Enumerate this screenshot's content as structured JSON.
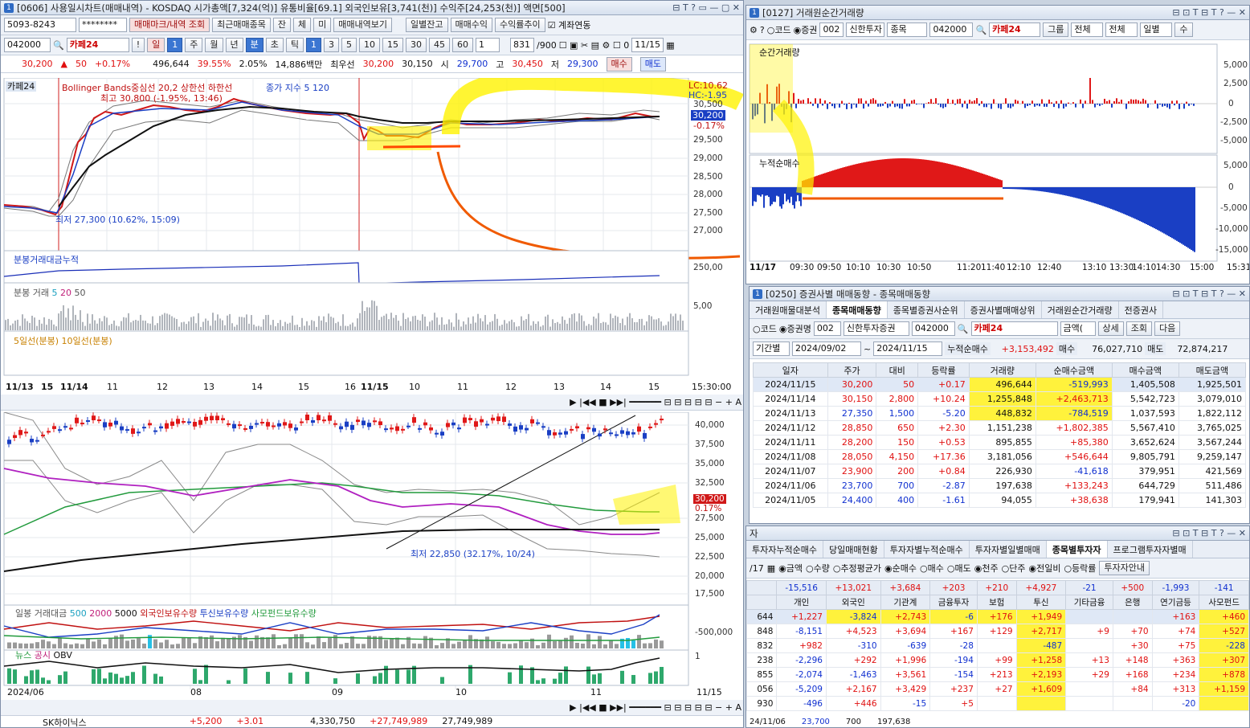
{
  "left_window": {
    "title": "[0606] 사용일시차트(매매내역) - KOSDAQ 시가총액[7,324(억)] 유통비율[69.1] 외국인보유[3,741(천)] 수익주[24,253(천)] 액면[500]",
    "account": "5093-8243",
    "password": "********",
    "buttons": [
      "매매마크/내역 조회",
      "최근매매종목",
      "잔",
      "체",
      "미",
      "매매내역보기",
      "일별잔고",
      "매매수익",
      "수익률추이"
    ],
    "checkbox_label": "계좌연동",
    "code": "042000",
    "stock_name": "카페24",
    "period_buttons": [
      "일",
      "1",
      "주",
      "월",
      "년",
      "분",
      "초",
      "틱",
      "1",
      "3",
      "5",
      "10",
      "15",
      "30",
      "45",
      "60",
      "1"
    ],
    "count": "831",
    "count_total": "/900",
    "date": "11/15",
    "quote": {
      "price": "30,200",
      "change": "50",
      "pct": "+0.17%",
      "volume": "496,644",
      "turnover": "39.55%",
      "ratio": "2.05%",
      "amount": "14,886백만",
      "best_label": "최우선",
      "best_ask": "30,200",
      "best_bid": "30,150",
      "open_label": "시",
      "open": "29,700",
      "high_label": "고",
      "high": "30,450",
      "low_label": "저",
      "low": "29,300",
      "buy": "매수",
      "sell": "매도"
    },
    "chart1": {
      "stock": "카페24",
      "legend": "Bollinger Bands중심선 20,2  상한선 하한선",
      "legend2": "종가 지수 5  120",
      "max_note": "최고 30,800 (-1.95%, 13:46)",
      "min_note": "최저 27,300 (10.62%, 15:09)",
      "lc": "LC:10.62",
      "hc": "HC:-1.95",
      "current": "30,200",
      "current_pct": "-0.17%",
      "yticks": [
        "30,500",
        "29,500",
        "29,000",
        "28,500",
        "28,000",
        "27,500",
        "27,000"
      ],
      "xticks": [
        "11/13",
        "15",
        "11/14",
        "11",
        "12",
        "13",
        "14",
        "15",
        "16",
        "11/15",
        "10",
        "11",
        "12",
        "13",
        "14",
        "15"
      ],
      "end_time": "15:30:00",
      "panel2": "분봉거래대금누적",
      "panel2_val": "250,00",
      "panel3": "분봉 거래",
      "panel3_ma": [
        "5",
        "20",
        "50"
      ],
      "panel3_val": "5,00",
      "panel4": "5일선(분봉)  10일선(분봉)"
    },
    "chart2": {
      "yticks": [
        "40,000",
        "37,500",
        "35,000",
        "32,500",
        "30,200",
        "0.17%",
        "27,500",
        "25,000",
        "22,500",
        "20,000",
        "17,500"
      ],
      "min_note": "최저 22,850 (32.17%, 10/24)",
      "vol_panel": "일봉 거래대금",
      "vol_ma": [
        "500",
        "2000",
        "5000"
      ],
      "vol_series": [
        "외국인보유수량",
        "투신보유수량",
        "사모펀드보유수량"
      ],
      "vol_val": "-500,000",
      "news_panel": "뉴스",
      "disclosure": "공시",
      "obv": "OBV",
      "obv_val": "1",
      "xticks": [
        "2024/06",
        "08",
        "09",
        "10",
        "11",
        "11/15"
      ]
    },
    "bottom_row": {
      "name": "SK하이닉스",
      "v1": "+5,200",
      "v2": "+3.01",
      "v3": "4,330,750",
      "v4": "+27,749,989",
      "v5": "27,749,989"
    }
  },
  "right_top": {
    "title": "[0127] 거래원순간거래량",
    "radio": [
      "코드",
      "증권"
    ],
    "broker_code": "002",
    "broker": "신한투자",
    "type": "종목",
    "code": "042000",
    "stock": "카페24",
    "options": [
      "그룹",
      "전체",
      "전체",
      "일별",
      "수"
    ],
    "panel1": "순간거래량",
    "panel1_ticks": [
      "5,000",
      "2,500",
      "0",
      "-2,500",
      "-5,000"
    ],
    "panel2": "누적순매수",
    "panel2_ticks": [
      "5,000",
      "0",
      "-5,000",
      "-10,000",
      "-15,000"
    ],
    "xticks": [
      "11/17",
      "09:30",
      "09:50",
      "10:10",
      "10:30",
      "10:50",
      "11:20",
      "11:40",
      "12:10",
      "12:40",
      "13:10",
      "13:30",
      "14:10",
      "14:30",
      "15:00",
      "15:31"
    ]
  },
  "right_mid": {
    "title": "[0250] 증권사별 매매동향 - 종목매매동향",
    "tabs": [
      "거래원매물대분석",
      "종목매매동향",
      "종목별증권사순위",
      "증권사별매매상위",
      "거래원순간거래량",
      "전증권사"
    ],
    "radio": [
      "코드",
      "증권명"
    ],
    "broker_code": "002",
    "broker": "신한투자증권",
    "code": "042000",
    "stock": "카페24",
    "amount_type": "금액(",
    "btns": [
      "상세",
      "조회",
      "다음"
    ],
    "period_label": "기간별",
    "date_from": "2024/09/02",
    "date_to": "2024/11/15",
    "net_label": "누적순매수",
    "net": "+3,153,492",
    "buy_label": "매수",
    "buy": "76,027,710",
    "sell_label": "매도",
    "sell": "72,874,217",
    "headers": [
      "일자",
      "주가",
      "대비",
      "등락률",
      "거래량",
      "순매수금액",
      "매수금액",
      "매도금액"
    ],
    "rows": [
      [
        "2024/11/15",
        "30,200",
        "50",
        "+0.17",
        "496,644",
        "-519,993",
        "1,405,508",
        "1,925,501"
      ],
      [
        "2024/11/14",
        "30,150",
        "2,800",
        "+10.24",
        "1,255,848",
        "+2,463,713",
        "5,542,723",
        "3,079,010"
      ],
      [
        "2024/11/13",
        "27,350",
        "1,500",
        "-5.20",
        "448,832",
        "-784,519",
        "1,037,593",
        "1,822,112"
      ],
      [
        "2024/11/12",
        "28,850",
        "650",
        "+2.30",
        "1,151,238",
        "+1,802,385",
        "5,567,410",
        "3,765,025"
      ],
      [
        "2024/11/11",
        "28,200",
        "150",
        "+0.53",
        "895,855",
        "+85,380",
        "3,652,624",
        "3,567,244"
      ],
      [
        "2024/11/08",
        "28,050",
        "4,150",
        "+17.36",
        "3,181,056",
        "+546,644",
        "9,805,791",
        "9,259,147"
      ],
      [
        "2024/11/07",
        "23,900",
        "200",
        "+0.84",
        "226,930",
        "-41,618",
        "379,951",
        "421,569"
      ],
      [
        "2024/11/06",
        "23,700",
        "700",
        "-2.87",
        "197,638",
        "+133,243",
        "644,729",
        "511,486"
      ],
      [
        "2024/11/05",
        "24,400",
        "400",
        "-1.61",
        "94,055",
        "+38,638",
        "179,941",
        "141,303"
      ]
    ]
  },
  "right_bot": {
    "title": "자",
    "tabs": [
      "투자자누적순매수",
      "당일매매현황",
      "투자자별누적순매수",
      "투자자별일별매매",
      "종목별투자자",
      "프로그램투자자별매"
    ],
    "radios": [
      "금액",
      "수량",
      "추정평균가",
      "순매수",
      "매수",
      "매도",
      "천주",
      "단주",
      "전일비",
      "등락률"
    ],
    "extra_btn": "투자자안내",
    "date": "/17",
    "totals": [
      "-15,516",
      "+13,021",
      "+3,684",
      "+203",
      "+210",
      "+4,927",
      "-21",
      "+500",
      "-1,993",
      "-141"
    ],
    "headers": [
      "개인",
      "외국인",
      "기관계",
      "금융투자",
      "보험",
      "투신",
      "기타금융",
      "은행",
      "연기금등",
      "사모펀드"
    ],
    "rows": [
      [
        "644",
        "+1,227",
        "-3,824",
        "+2,743",
        "-6",
        "+176",
        "+1,949",
        "",
        "",
        "+163",
        "+460"
      ],
      [
        "848",
        "-8,151",
        "+4,523",
        "+3,694",
        "+167",
        "+129",
        "+2,717",
        "+9",
        "+70",
        "+74",
        "+527"
      ],
      [
        "832",
        "+982",
        "-310",
        "-639",
        "-28",
        "",
        "-487",
        "",
        "+30",
        "+75",
        "-228"
      ],
      [
        "238",
        "-2,296",
        "+292",
        "+1,996",
        "-194",
        "+99",
        "+1,258",
        "+13",
        "+148",
        "+363",
        "+307"
      ],
      [
        "855",
        "-2,074",
        "-1,463",
        "+3,561",
        "-154",
        "+213",
        "+2,193",
        "+29",
        "+168",
        "+234",
        "+878"
      ],
      [
        "056",
        "-5,209",
        "+2,167",
        "+3,429",
        "+237",
        "+27",
        "+1,609",
        "",
        "+84",
        "+313",
        "+1,159"
      ],
      [
        "930",
        "-496",
        "+446",
        "-15",
        "+5",
        "",
        "",
        "",
        "",
        "-20",
        ""
      ]
    ],
    "bottom_row": {
      "date": "24/11/06",
      "price": "23,700",
      "v": "700",
      "vol": "197,638"
    }
  }
}
